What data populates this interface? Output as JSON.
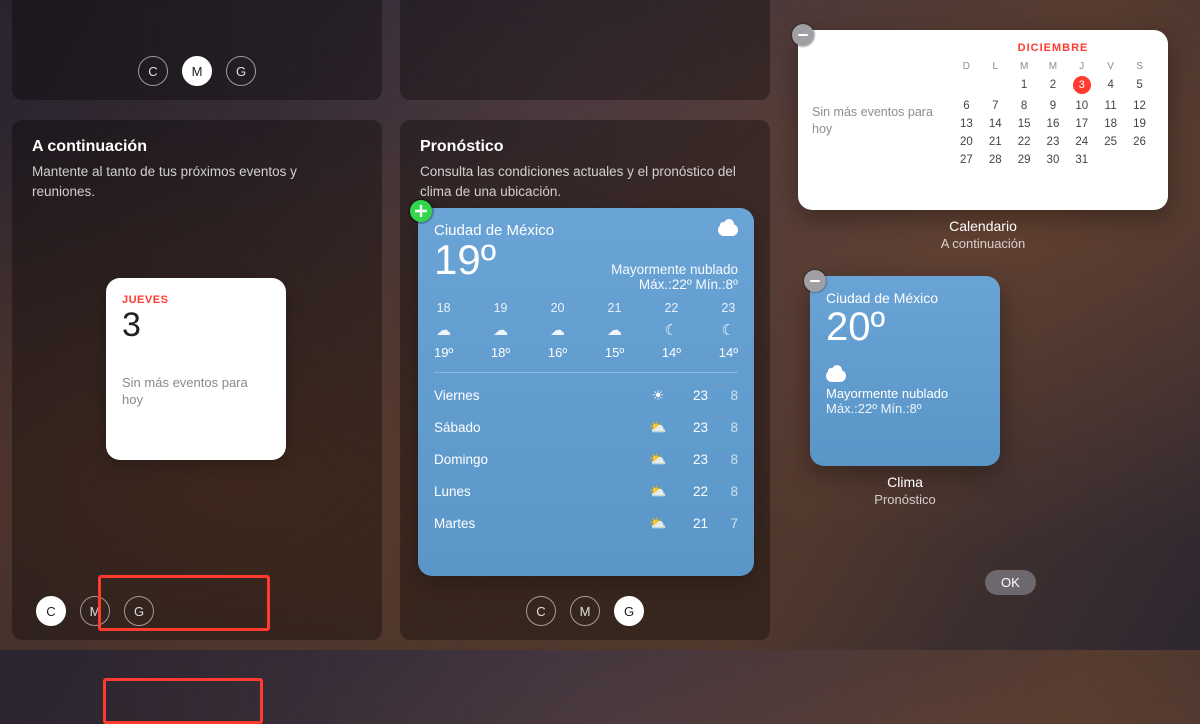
{
  "top_sizebar": {
    "c": "C",
    "m": "M",
    "g": "G",
    "active": "M"
  },
  "next": {
    "title": "A continuación",
    "desc": "Mantente al tanto de tus próximos eventos y reuniones.",
    "card": {
      "dow": "JUEVES",
      "daynum": "3",
      "msg": "Sin más eventos para hoy"
    },
    "size": {
      "c": "C",
      "m": "M",
      "g": "G",
      "active": "C"
    }
  },
  "forecast": {
    "title": "Pronóstico",
    "desc": "Consulta las condiciones actuales y el pronóstico del clima de una ubicación.",
    "city": "Ciudad de México",
    "temp": "19º",
    "cond_line": "Mayormente nublado",
    "minmax": "Máx.:22º Mín.:8º",
    "hourly": [
      {
        "h": "18",
        "i": "☁",
        "t": "19º"
      },
      {
        "h": "19",
        "i": "☁",
        "t": "18º"
      },
      {
        "h": "20",
        "i": "☁",
        "t": "16º"
      },
      {
        "h": "21",
        "i": "☁",
        "t": "15º"
      },
      {
        "h": "22",
        "i": "☾",
        "t": "14º"
      },
      {
        "h": "23",
        "i": "☾",
        "t": "14º"
      }
    ],
    "daily": [
      {
        "n": "Viernes",
        "i": "☀",
        "h": "23",
        "l": "8"
      },
      {
        "n": "Sábado",
        "i": "⛅",
        "h": "23",
        "l": "8"
      },
      {
        "n": "Domingo",
        "i": "⛅",
        "h": "23",
        "l": "8"
      },
      {
        "n": "Lunes",
        "i": "⛅",
        "h": "22",
        "l": "8"
      },
      {
        "n": "Martes",
        "i": "⛅",
        "h": "21",
        "l": "7"
      }
    ],
    "size": {
      "c": "C",
      "m": "M",
      "g": "G",
      "active": "G"
    }
  },
  "placed_cal": {
    "month": "DICIEMBRE",
    "left_msg": "Sin más eventos para hoy",
    "dow": [
      "D",
      "L",
      "M",
      "M",
      "J",
      "V",
      "S"
    ],
    "weeks": [
      [
        "",
        "",
        "1",
        "2",
        "3",
        "4",
        "5"
      ],
      [
        "6",
        "7",
        "8",
        "9",
        "10",
        "11",
        "12"
      ],
      [
        "13",
        "14",
        "15",
        "16",
        "17",
        "18",
        "19"
      ],
      [
        "20",
        "21",
        "22",
        "23",
        "24",
        "25",
        "26"
      ],
      [
        "27",
        "28",
        "29",
        "30",
        "31",
        "",
        ""
      ]
    ],
    "today": "3",
    "caption_t": "Calendario",
    "caption_s": "A continuación"
  },
  "placed_weather": {
    "city": "Ciudad de México",
    "temp": "20º",
    "cond": "Mayormente nublado",
    "minmax": "Máx.:22º Mín.:8º",
    "caption_t": "Clima",
    "caption_s": "Pronóstico"
  },
  "ok": "OK"
}
